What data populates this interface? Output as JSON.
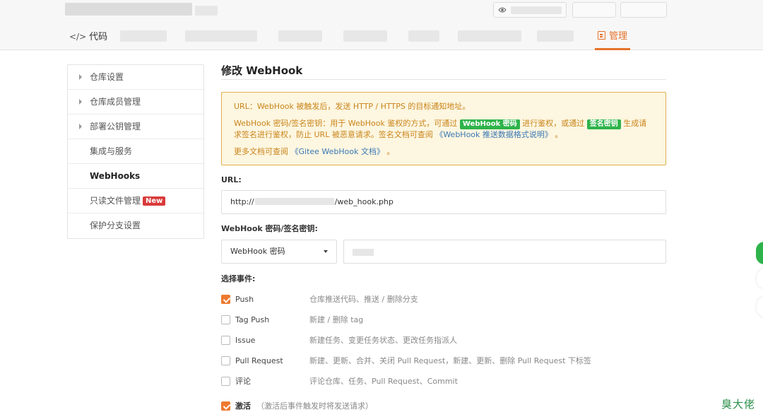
{
  "header": {
    "tabs": {
      "code_label": "代码",
      "manage_label": "管理"
    }
  },
  "sidebar": {
    "items": [
      {
        "label": "仓库设置"
      },
      {
        "label": "仓库成员管理"
      },
      {
        "label": "部署公钥管理"
      },
      {
        "label": "集成与服务"
      },
      {
        "label": "WebHooks"
      },
      {
        "label": "只读文件管理",
        "badge": "New"
      },
      {
        "label": "保护分支设置"
      }
    ]
  },
  "main": {
    "title": "修改 WebHook",
    "notice": {
      "line1": "URL：WebHook 被触发后，发送 HTTP / HTTPS 的目标通知地址。",
      "line2_a": "WebHook 密码/签名密钥：用于 WebHook 鉴权的方式，可通过",
      "tag_password": "WebHook 密码",
      "line2_b": "进行鉴权，或通过",
      "tag_sign": "签名密钥",
      "line2_c": "生成请求签名进行鉴权，防止 URL 被恶意请求。签名文档可查阅",
      "link_format": "《WebHook 推送数据格式说明》",
      "line2_end": "。",
      "line3_a": "更多文档可查阅",
      "link_docs": "《Gitee WebHook 文档》",
      "line3_end": "。"
    },
    "url_label": "URL:",
    "url_prefix": "http://",
    "url_suffix": "/web_hook.php",
    "secret_label": "WebHook 密码/签名密钥:",
    "secret_select_value": "WebHook 密码",
    "events_label": "选择事件:",
    "events": [
      {
        "name": "Push",
        "desc": "仓库推送代码、推送 / 删除分支",
        "checked": true
      },
      {
        "name": "Tag Push",
        "desc": "新建 / 删除 tag",
        "checked": false
      },
      {
        "name": "Issue",
        "desc": "新建任务、变更任务状态、更改任务指派人",
        "checked": false
      },
      {
        "name": "Pull Request",
        "desc": "新建、更新、合并、关闭 Pull Request，新建、更新、删除 Pull Request 下标签",
        "checked": false
      },
      {
        "name": "评论",
        "desc": "评论仓库、任务、Pull Request、Commit",
        "checked": false
      }
    ],
    "activate": {
      "label": "激活",
      "hint": "（激活后事件触发时将发送请求）",
      "checked": true
    }
  },
  "watermark": "臭大佬",
  "colors": {
    "accent": "#e5722a",
    "checkbox": "#ee7a2f",
    "notice_bg": "#fdf6e0",
    "notice_border": "#e0b04d",
    "tag_green": "#2eb34a",
    "badge_red": "#d93a3a"
  }
}
